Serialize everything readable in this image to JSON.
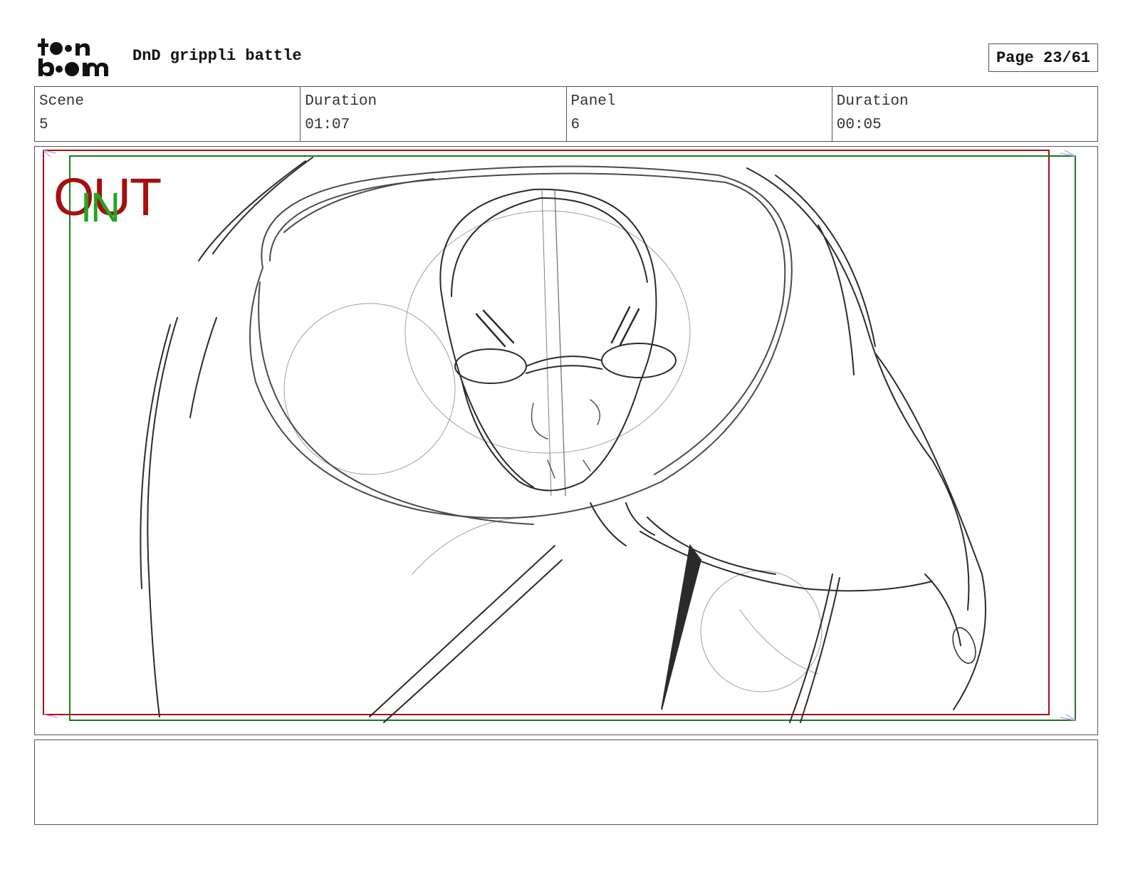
{
  "header": {
    "logo_text": "toonboom",
    "project_title": "DnD grippli battle",
    "page_label": "Page",
    "page_value": "23/61"
  },
  "info": [
    {
      "label": "Scene",
      "value": "5"
    },
    {
      "label": "Duration",
      "value": "01:07"
    },
    {
      "label": "Panel",
      "value": "6"
    },
    {
      "label": "Duration",
      "value": "00:05"
    }
  ],
  "frame_labels": {
    "out": "OUT",
    "in": "IN"
  },
  "colors": {
    "out_frame": "#a50f0f",
    "in_frame": "#1c7a1c",
    "in_label": "#22a722",
    "sketch": "#2b2b2b"
  },
  "caption": ""
}
